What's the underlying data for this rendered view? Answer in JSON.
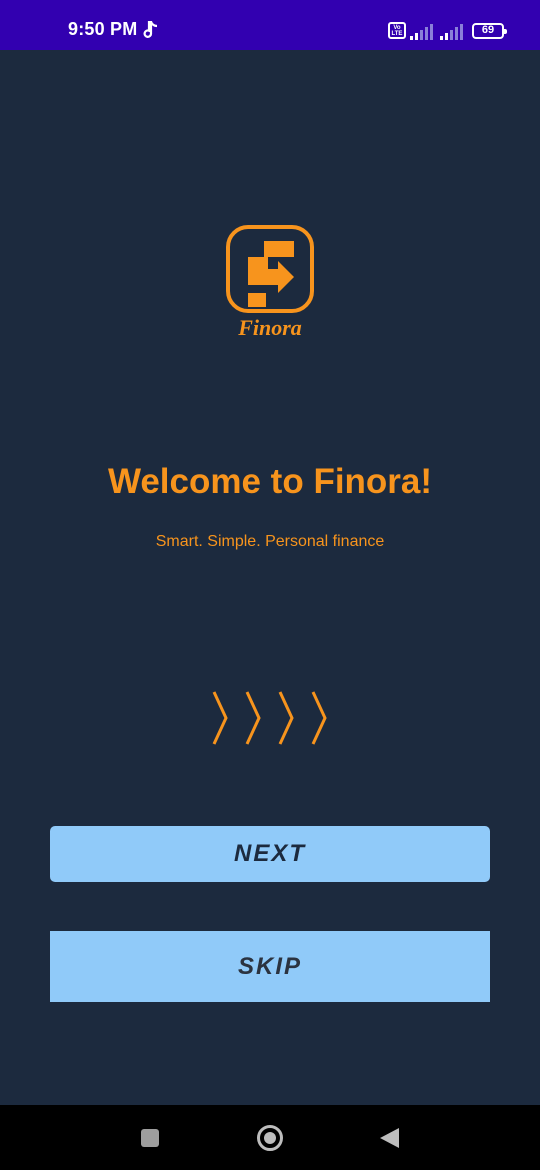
{
  "status_bar": {
    "time": "9:50 PM",
    "volte_label": "Vo LTE",
    "battery_percent": "69",
    "icons": [
      "music-note-icon",
      "volte-icon",
      "signal-icon",
      "signal-icon",
      "battery-icon"
    ]
  },
  "logo": {
    "wordmark": "Finora",
    "icon": "finora-logo-icon",
    "color": "#f7941d"
  },
  "welcome": {
    "title": "Welcome to Finora!",
    "tagline": "Smart. Simple. Personal finance"
  },
  "pager_indicator": {
    "icon": "chevrons-icon",
    "count": 4
  },
  "buttons": {
    "next_label": "NEXT",
    "skip_label": "SKIP"
  },
  "nav_bar": {
    "icons": [
      "recent-apps-icon",
      "home-icon",
      "back-icon"
    ]
  },
  "colors": {
    "background": "#1c2a3e",
    "status_bar": "#3200b0",
    "accent": "#f7941d",
    "button": "#90caf9",
    "button_text": "#1c2a3e"
  }
}
